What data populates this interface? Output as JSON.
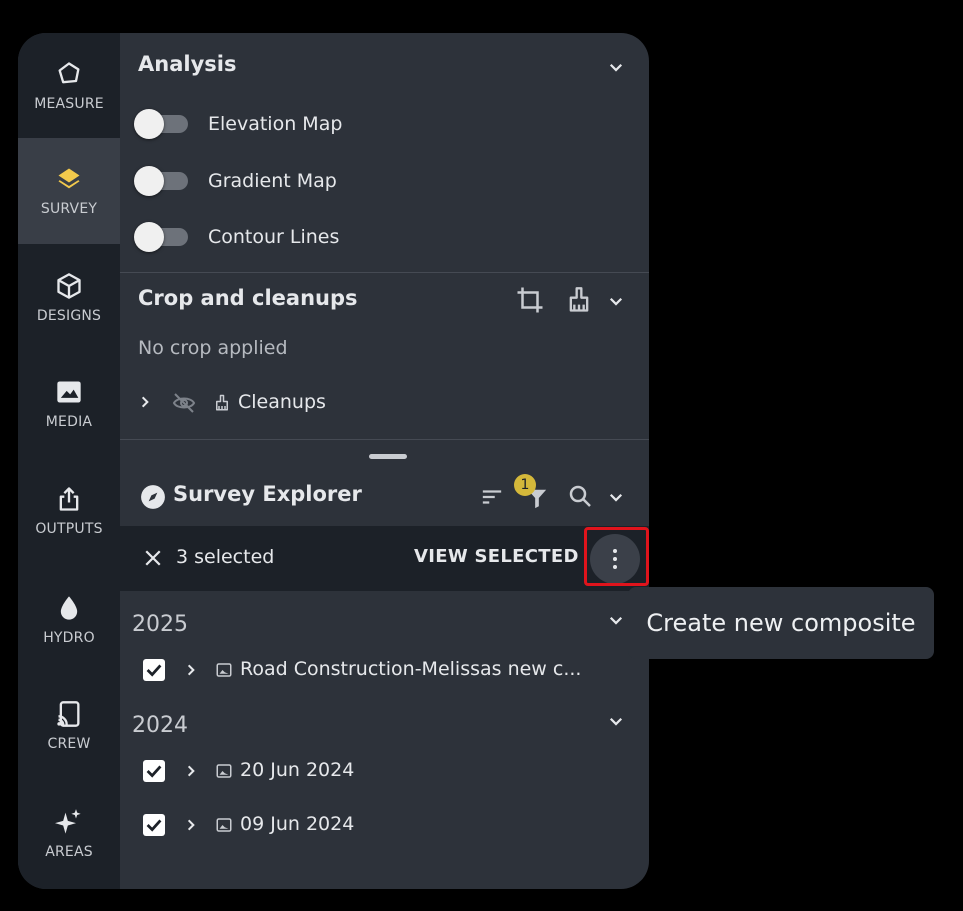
{
  "rail": {
    "items": [
      {
        "label": "MEASURE",
        "icon": "polygon-icon"
      },
      {
        "label": "SURVEY",
        "icon": "layers-icon",
        "active": true
      },
      {
        "label": "DESIGNS",
        "icon": "cube-icon"
      },
      {
        "label": "MEDIA",
        "icon": "image-icon"
      },
      {
        "label": "OUTPUTS",
        "icon": "share-icon"
      },
      {
        "label": "HYDRO",
        "icon": "water-drop-icon"
      },
      {
        "label": "CREW",
        "icon": "cast-icon"
      },
      {
        "label": "AREAS",
        "icon": "sparkle-icon"
      }
    ]
  },
  "analysis": {
    "title": "Analysis",
    "toggles": [
      {
        "label": "Elevation Map",
        "on": false
      },
      {
        "label": "Gradient Map",
        "on": false
      },
      {
        "label": "Contour Lines",
        "on": false
      }
    ]
  },
  "crop": {
    "title": "Crop and cleanups",
    "status": "No crop applied",
    "cleanups_label": "Cleanups"
  },
  "explorer": {
    "title": "Survey Explorer",
    "filter_count": "1",
    "selected_text": "3 selected",
    "view_selected_label": "VIEW SELECTED",
    "groups": [
      {
        "year": "2025",
        "items": [
          "Road Construction-Melissas new c..."
        ]
      },
      {
        "year": "2024",
        "items": [
          "20 Jun 2024",
          "09 Jun 2024"
        ]
      }
    ]
  },
  "tooltip": {
    "text": "Create new composite"
  },
  "colors": {
    "accent": "#f2c94c",
    "panel": "#2d323a",
    "rail": "#1c2128",
    "highlight": "#e0141c"
  }
}
